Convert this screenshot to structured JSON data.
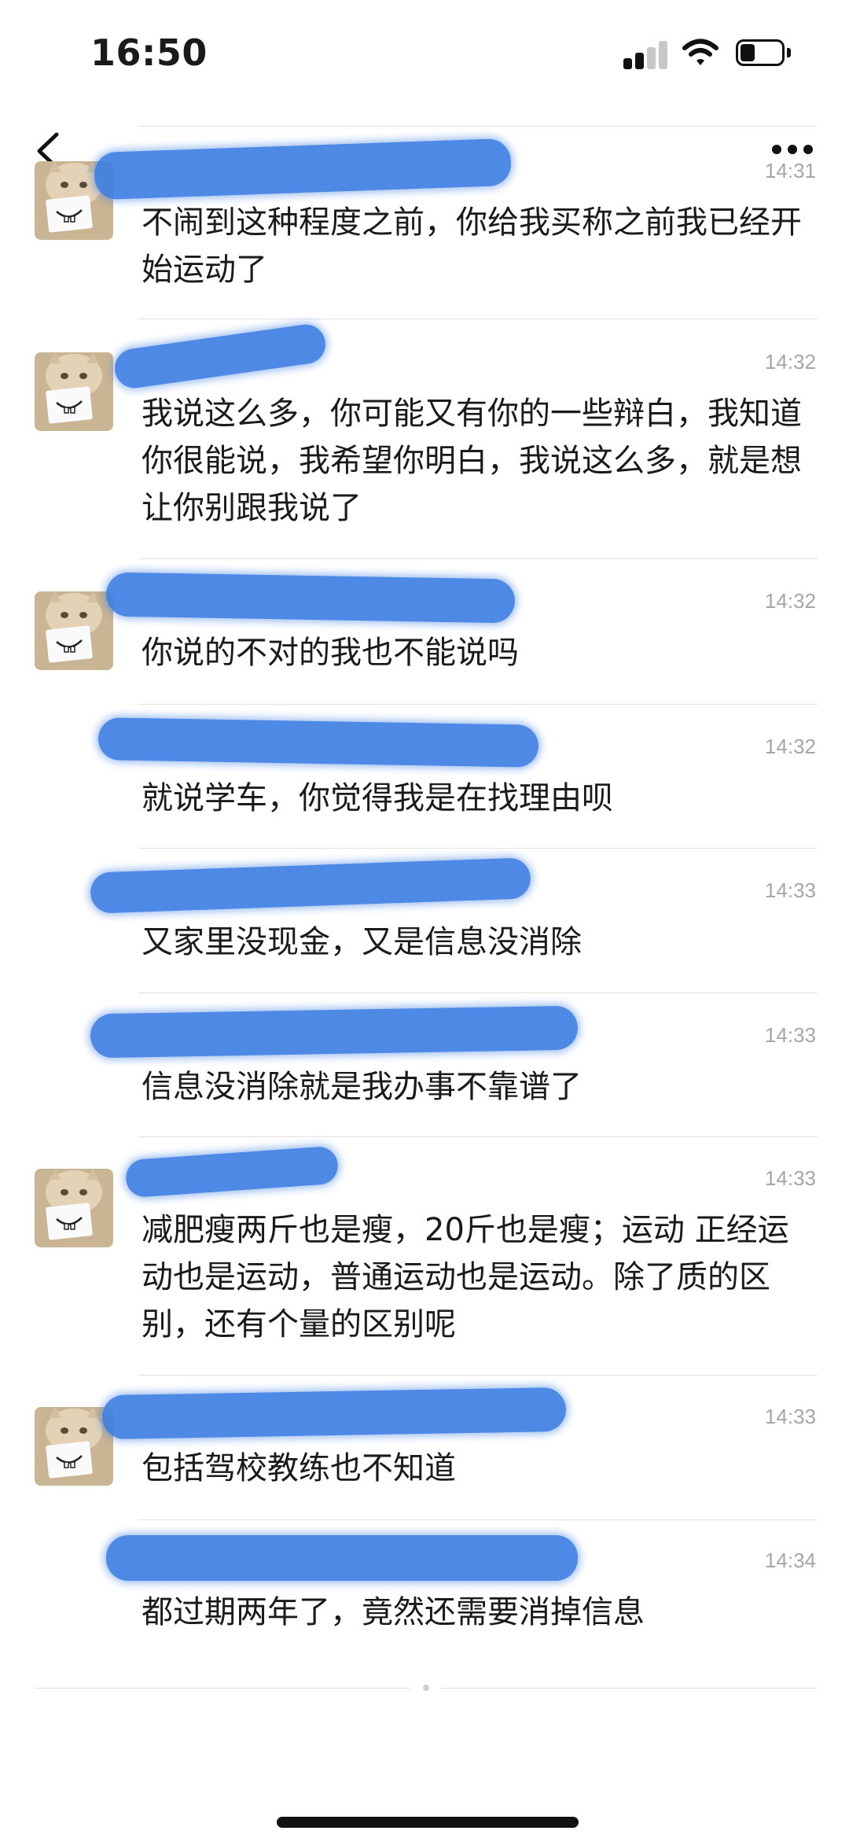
{
  "status_bar": {
    "time": "16:50",
    "battery_level": 0.35
  },
  "header": {
    "back_icon": "chevron-left-icon",
    "more_icon": "more-dots-icon"
  },
  "messages": [
    {
      "time": "14:31",
      "text": "不闹到这种程度之前，你给我买称之前我已经开始运动了",
      "avatar": "cat-with-paper-mask-avatar"
    },
    {
      "time": "14:32",
      "text": "我说这么多，你可能又有你的一些辩白，我知道你很能说，我希望你明白，我说这么多，就是想让你别跟我说了",
      "avatar": "cat-with-paper-mask-avatar"
    },
    {
      "time": "14:32",
      "text": "你说的不对的我也不能说吗",
      "avatar": "cat-with-paper-mask-avatar"
    },
    {
      "time": "14:32",
      "text": "就说学车，你觉得我是在找理由呗"
    },
    {
      "time": "14:33",
      "text": "又家里没现金，又是信息没消除"
    },
    {
      "time": "14:33",
      "text": "信息没消除就是我办事不靠谱了"
    },
    {
      "time": "14:33",
      "text": "减肥瘦两斤也是瘦，20斤也是瘦；运动 正经运动也是运动，普通运动也是运动。除了质的区别，还有个量的区别呢",
      "avatar": "cat-with-paper-mask-avatar"
    },
    {
      "time": "14:33",
      "text": "包括驾校教练也不知道",
      "avatar": "cat-with-paper-mask-avatar"
    },
    {
      "time": "14:34",
      "text": "都过期两年了，竟然还需要消掉信息"
    }
  ]
}
